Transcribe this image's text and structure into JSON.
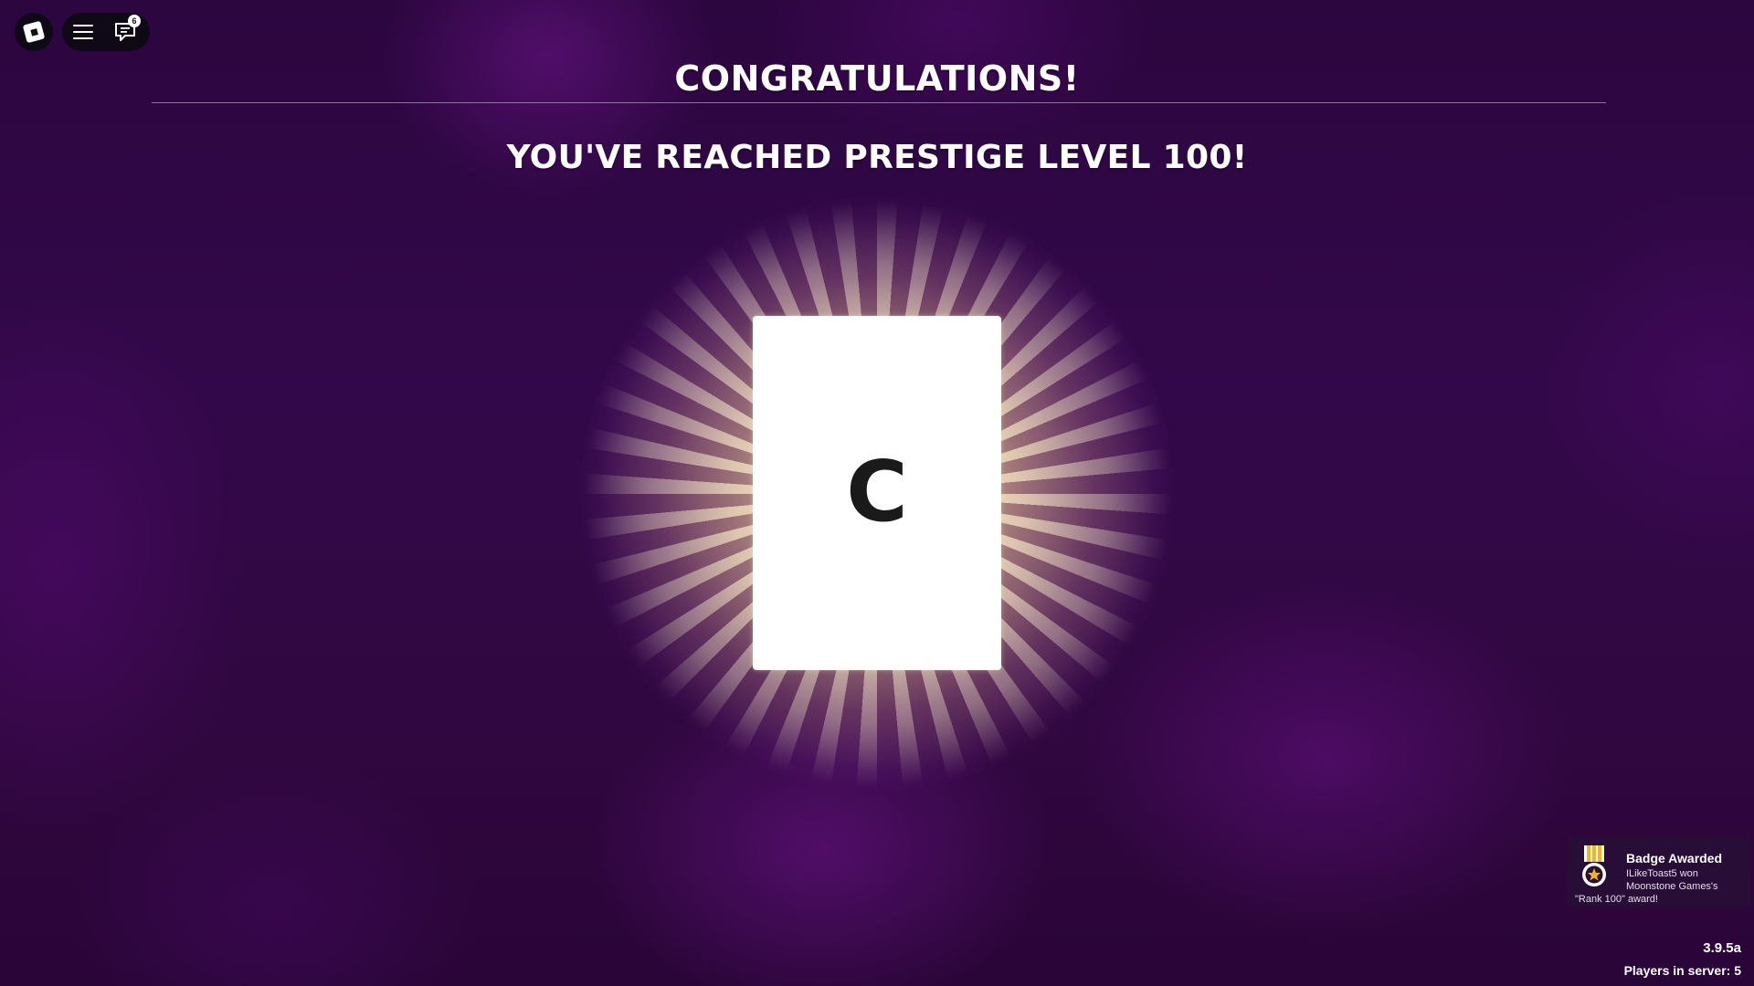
{
  "topbar": {
    "logo_icon": "roblox-logo-icon",
    "menu_icon": "hamburger-menu-icon",
    "chat_icon": "chat-icon",
    "chat_badge_count": "6"
  },
  "screen": {
    "title": "CONGRATULATIONS!",
    "subtitle": "YOU'VE REACHED PRESTIGE LEVEL 100!",
    "card_letter": "C"
  },
  "notification": {
    "icon": "medal-icon",
    "title": "Badge Awarded",
    "line1": "ILikeToast5 won",
    "line2": "Moonstone Games's",
    "line3": "\"Rank 100\" award!"
  },
  "footer": {
    "version": "3.9.5a",
    "players": "Players in server: 5"
  },
  "colors": {
    "background": "#2c063f",
    "glow": "#ffecbe",
    "card": "#ffffff",
    "text": "#ffffff"
  }
}
